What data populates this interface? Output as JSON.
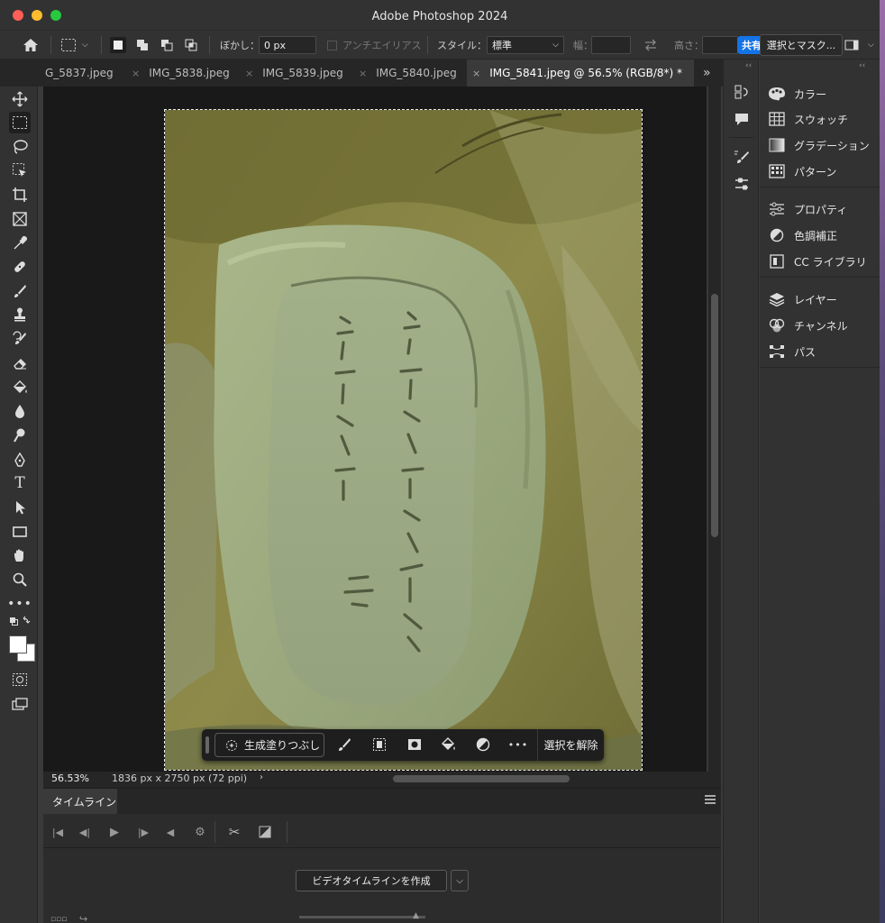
{
  "window": {
    "title": "Adobe Photoshop 2024"
  },
  "options": {
    "feather_label": "ぼかし：",
    "feather_value": "0 px",
    "antialias_label": "アンチエイリアス",
    "style_label": "スタイル：",
    "style_value": "標準",
    "width_label": "幅：",
    "height_label": "高さ：",
    "share_label": "共有",
    "select_mask_label": "選択とマスク..."
  },
  "tabs": [
    {
      "label": "G_5837.jpeg"
    },
    {
      "label": "IMG_5838.jpeg"
    },
    {
      "label": "IMG_5839.jpeg"
    },
    {
      "label": "IMG_5840.jpeg"
    },
    {
      "label": "IMG_5841.jpeg @ 56.5% (RGB/8*) *"
    }
  ],
  "status": {
    "zoom": "56.53%",
    "doc_info": "1836 px x 2750 px (72 ppi)"
  },
  "context_bar": {
    "generative_fill": "生成塗りつぶし",
    "deselect": "選択を解除"
  },
  "timeline": {
    "tab_label": "タイムライン",
    "create_button": "ビデオタイムラインを作成"
  },
  "panels": {
    "group1": [
      "カラー",
      "スウォッチ",
      "グラデーション",
      "パターン"
    ],
    "group2": [
      "プロパティ",
      "色調補正",
      "CC ライブラリ"
    ],
    "group3": [
      "レイヤー",
      "チャンネル",
      "パス"
    ]
  },
  "colors": {
    "accent": "#1473e6",
    "app_bg": "#323232",
    "canvas_bg": "#191919"
  }
}
